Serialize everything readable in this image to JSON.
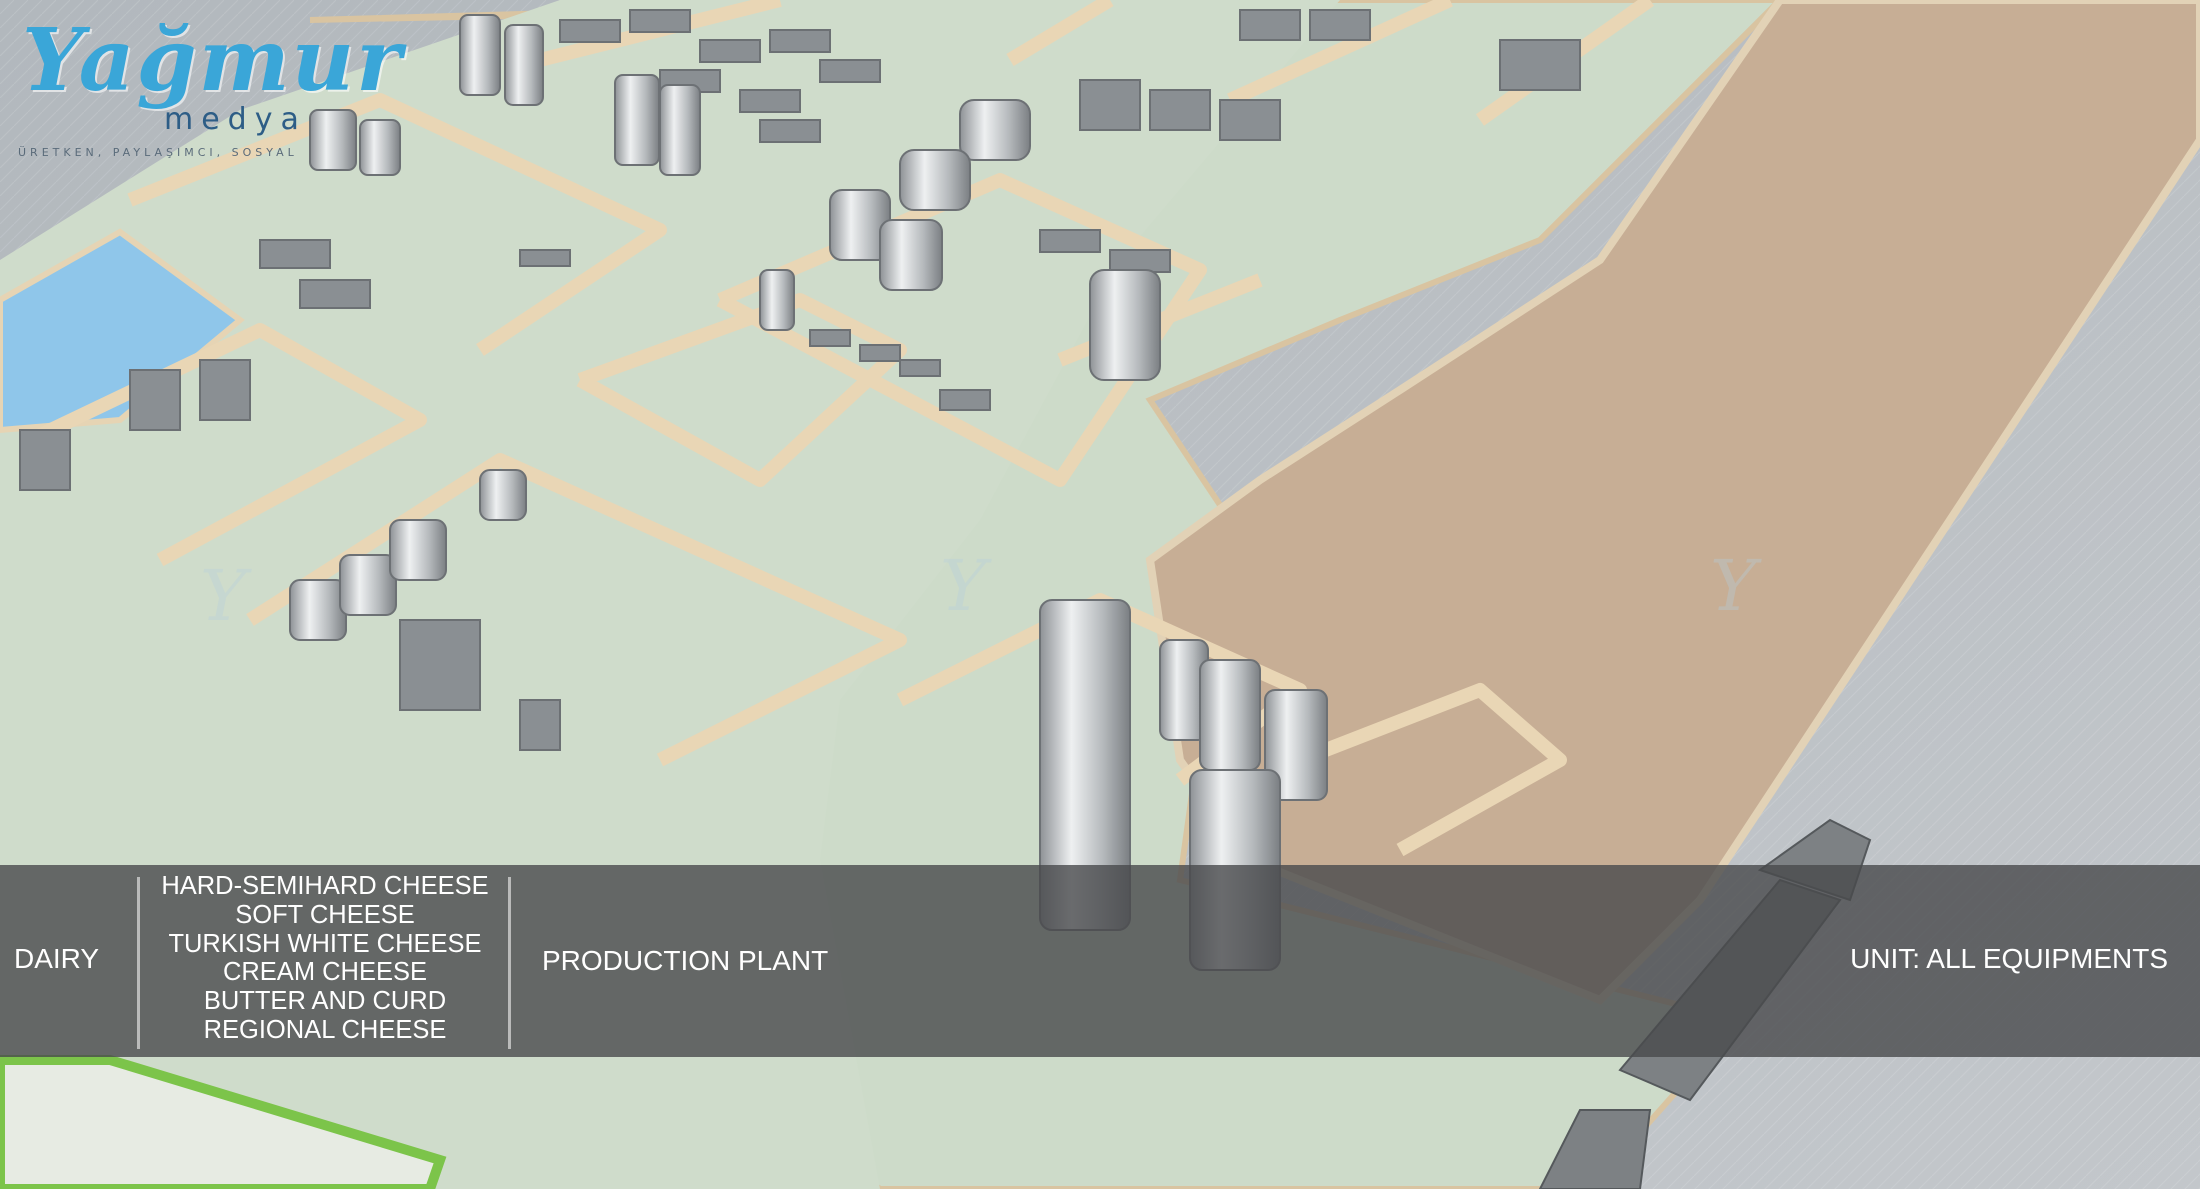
{
  "logo": {
    "script": "Yağmur",
    "sub": "medya",
    "tagline": "ÜRETKEN, PAYLAŞIMCI, SOSYAL"
  },
  "banner": {
    "category": "DAIRY",
    "products": [
      "HARD-SEMIHARD CHEESE",
      "SOFT CHEESE",
      "TURKISH WHITE CHEESE",
      "CREAM CHEESE",
      "BUTTER AND CURD",
      "REGIONAL CHEESE"
    ],
    "facility": "PRODUCTION PLANT",
    "unit": "UNIT: ALL EQUIPMENTS"
  },
  "colors": {
    "floor": "#cfdccb",
    "wall": "#e8d8b8",
    "open_area": "#c6ad94",
    "pool": "#8fc6ea",
    "ground": "#b7bcc1",
    "steel": "#c9ccce",
    "banner": "#4a4c4e"
  }
}
